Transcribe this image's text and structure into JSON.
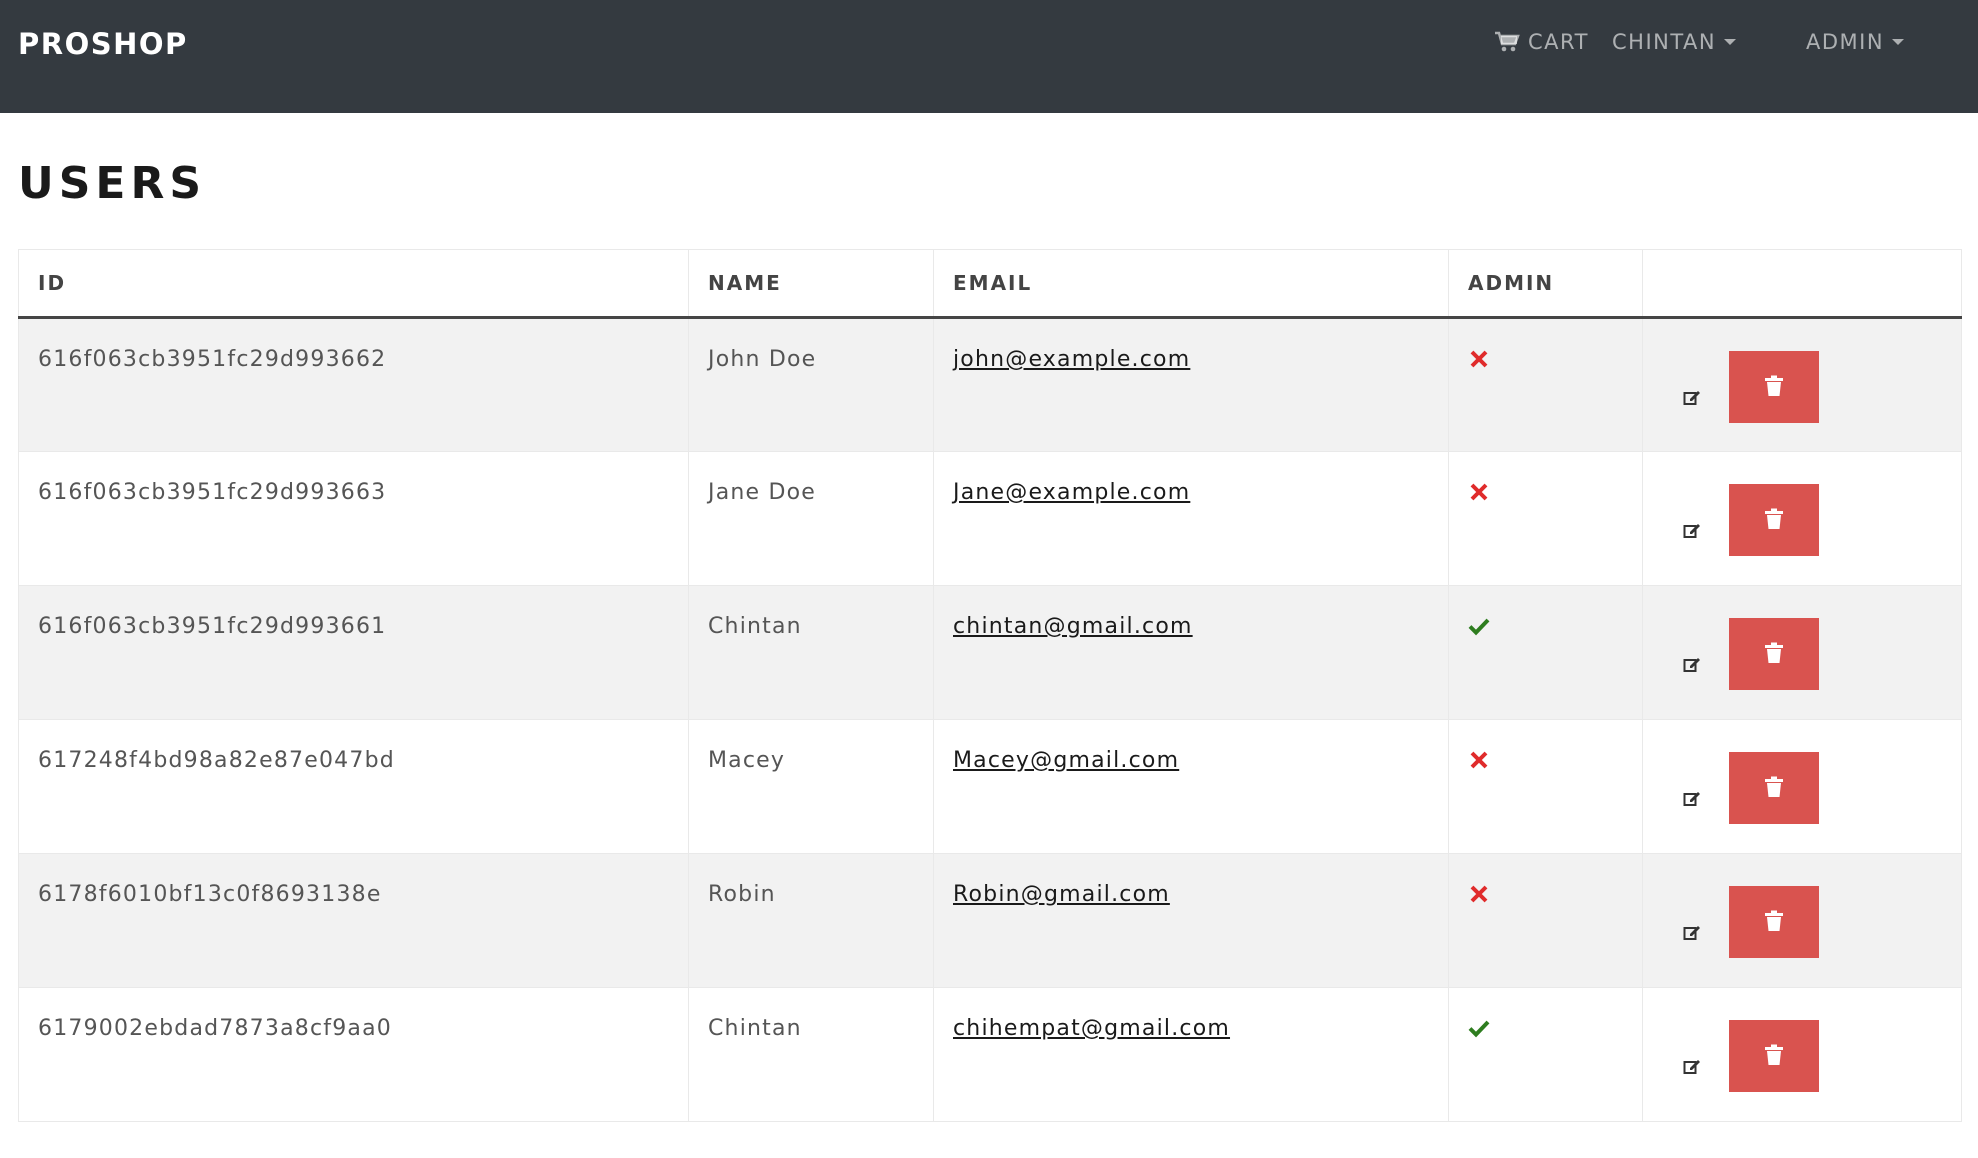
{
  "navbar": {
    "brand": "PROSHOP",
    "cart_label": "CART",
    "user_label": "CHINTAN",
    "admin_label": "ADMIN"
  },
  "page": {
    "title": "USERS"
  },
  "table": {
    "headers": [
      "ID",
      "NAME",
      "EMAIL",
      "ADMIN",
      ""
    ],
    "rows": [
      {
        "id": "616f063cb3951fc29d993662",
        "name": "John Doe",
        "email": "john@example.com",
        "admin": false
      },
      {
        "id": "616f063cb3951fc29d993663",
        "name": "Jane Doe",
        "email": "Jane@example.com",
        "admin": false
      },
      {
        "id": "616f063cb3951fc29d993661",
        "name": "Chintan",
        "email": "chintan@gmail.com",
        "admin": true
      },
      {
        "id": "617248f4bd98a82e87e047bd",
        "name": "Macey",
        "email": "Macey@gmail.com",
        "admin": false
      },
      {
        "id": "6178f6010bf13c0f8693138e",
        "name": "Robin",
        "email": "Robin@gmail.com",
        "admin": false
      },
      {
        "id": "6179002ebdad7873a8cf9aa0",
        "name": "Chintan",
        "email": "chihempat@gmail.com",
        "admin": true
      }
    ]
  },
  "icons": {
    "cart": "cart-icon",
    "admin_true": "check-icon",
    "admin_false": "x-icon",
    "edit": "edit-icon",
    "delete": "trash-icon"
  },
  "colors": {
    "navbar_bg": "#343a40",
    "check": "#2e7d1f",
    "cross": "#e02b2b",
    "delete_button": "#d9534f"
  }
}
